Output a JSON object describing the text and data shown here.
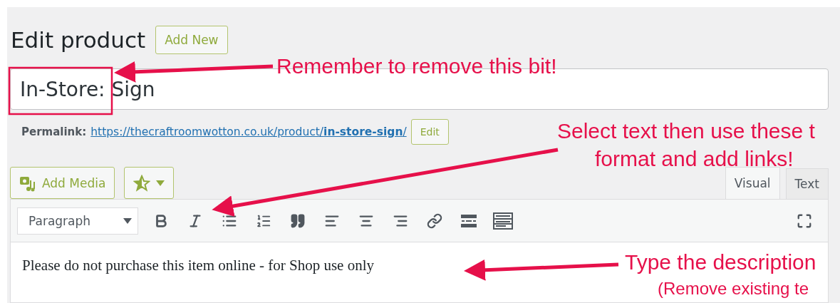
{
  "header": {
    "title": "Edit product",
    "add_new": "Add New"
  },
  "title_field": {
    "value": "In-Store: Sign"
  },
  "permalink": {
    "label": "Permalink:",
    "base": "https://thecraftroomwotton.co.uk/product/",
    "slug": "in-store-sign",
    "trail": "/",
    "edit": "Edit"
  },
  "media": {
    "add_media": "Add Media"
  },
  "editor_tabs": [
    {
      "label": "Visual",
      "selected": true
    },
    {
      "label": "Text",
      "selected": false
    }
  ],
  "toolbar": {
    "format": "Paragraph",
    "tools": [
      {
        "kind": "bold"
      },
      {
        "kind": "italic"
      },
      {
        "kind": "bullets"
      },
      {
        "kind": "numbers"
      },
      {
        "kind": "quote"
      },
      {
        "kind": "align-left"
      },
      {
        "kind": "align-center"
      },
      {
        "kind": "align-right"
      },
      {
        "kind": "link"
      },
      {
        "kind": "more"
      },
      {
        "kind": "toolbar"
      }
    ]
  },
  "content": "Please do not purchase this item online - for Shop use only",
  "annotations": [
    {
      "lines": [
        "Remember to remove this bit!"
      ]
    },
    {
      "lines": [
        "Select text then use these t",
        "format and add links!"
      ]
    },
    {
      "lines": [
        "Type the description",
        "(Remove existing te"
      ]
    }
  ]
}
